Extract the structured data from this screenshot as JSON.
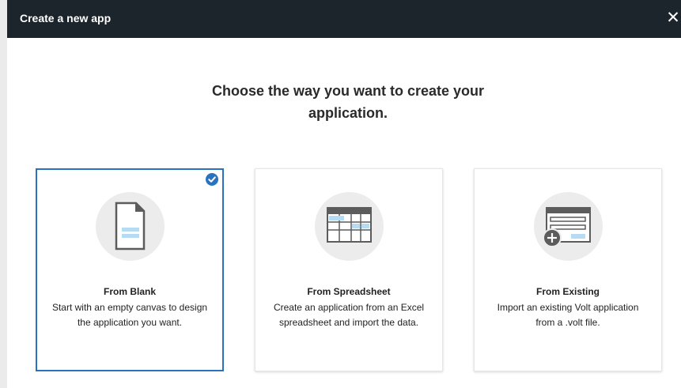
{
  "dialog": {
    "title": "Create a new app",
    "close_label": "✕",
    "heading_line1": "Choose the way you want to create your",
    "heading_line2": "application."
  },
  "accent_color": "#2872c0",
  "header_color": "#1c242c",
  "options": [
    {
      "title": "From Blank",
      "description": "Start with an empty canvas to design the application you want.",
      "icon": "blank-document-icon",
      "selected": true
    },
    {
      "title": "From Spreadsheet",
      "description": "Create an application from an Excel spreadsheet and import the data.",
      "icon": "spreadsheet-icon",
      "selected": false
    },
    {
      "title": "From Existing",
      "description": "Import an existing Volt application from a .volt file.",
      "icon": "import-form-icon",
      "selected": false
    }
  ]
}
